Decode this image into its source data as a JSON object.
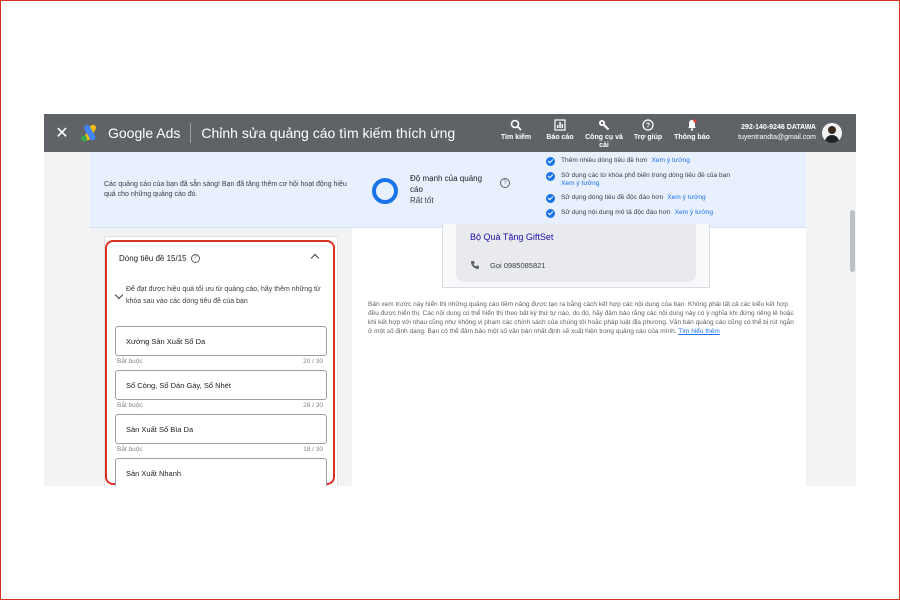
{
  "topbar": {
    "close_label": "✕",
    "brand": "Google Ads",
    "title": "Chỉnh sửa quảng cáo tìm kiếm thích ứng",
    "tools": [
      {
        "icon": "search-icon",
        "label": "Tìm kiếm"
      },
      {
        "icon": "reports-icon",
        "label": "Báo cáo"
      },
      {
        "icon": "wrench-icon",
        "label": "Công cụ và cài"
      },
      {
        "icon": "help-icon",
        "label": "Trợ giúp"
      },
      {
        "icon": "bell-icon",
        "label": "Thông báo"
      }
    ],
    "account_phone": "292-140-9246 DATAWA",
    "account_email": "tuyentrandta@gmail.com"
  },
  "banner": {
    "message": "Các quảng cáo của bạn đã sẵn sàng! Bạn đã tăng thêm cơ hội hoạt động hiệu quả cho những quảng cáo đó.",
    "strength_label": "Độ mạnh của quảng cáo",
    "strength_value": "Rất tốt",
    "tips": [
      {
        "text": "Thêm nhiều dòng tiêu đề hơn",
        "link": "Xem ý tưởng"
      },
      {
        "text": "Sử dụng các từ khóa phổ biến trong dòng tiêu đề của bạn",
        "link": "Xem ý tưởng"
      },
      {
        "text": "Sử dụng dòng tiêu đề độc đáo hơn",
        "link": "Xem ý tưởng"
      },
      {
        "text": "Sử dụng nội dung mô tả độc đáo hơn",
        "link": "Xem ý tưởng"
      }
    ]
  },
  "headlines": {
    "title": "Dòng tiêu đề 15/15",
    "description": "Để đạt được hiệu quả tối ưu từ quảng cáo, hãy thêm những từ khóa sau vào các dòng tiêu đề của bạn",
    "fields": [
      {
        "value": "Xưởng Sản Xuất Sổ Da",
        "hint": "Bắt buộc",
        "count": "20 / 30"
      },
      {
        "value": "Sổ Còng, Sổ Dán Gáy, Sổ Nhét",
        "hint": "Bắt buộc",
        "count": "28 / 30"
      },
      {
        "value": "Sản Xuất Sổ Bìa Da",
        "hint": "Bắt buộc",
        "count": "18 / 30"
      },
      {
        "value": "Sản Xuất Nhanh"
      }
    ]
  },
  "preview": {
    "ad_title": "Bộ Quà Tặng GiftSet",
    "call_text": "Gọi 0985085821",
    "disclaimer": "Bản xem trước này hiển thị những quảng cáo tiềm năng được tạo ra bằng cách kết hợp các nội dung của bạn. Không phải tất cả các kiểu kết hợp đều được hiển thị. Các nội dung có thể hiển thị theo bất kỳ thứ tự nào, do đó, hãy đảm bảo rằng các nội dung này có ý nghĩa khi đứng riêng lẻ hoặc khi kết hợp với nhau cũng như không vi phạm các chính sách của chúng tôi hoặc pháp luật địa phương. Văn bản quảng cáo cũng có thể bị rút ngắn ở một số định dạng. Bạn có thể đảm bảo một số văn bản nhất định sẽ xuất hiện trong quảng cáo của mình.",
    "learn_more": "Tìm hiểu thêm"
  },
  "colors": {
    "topbar": "#5f6368",
    "accent": "#1a73e8",
    "highlight_border": "#d93025"
  }
}
